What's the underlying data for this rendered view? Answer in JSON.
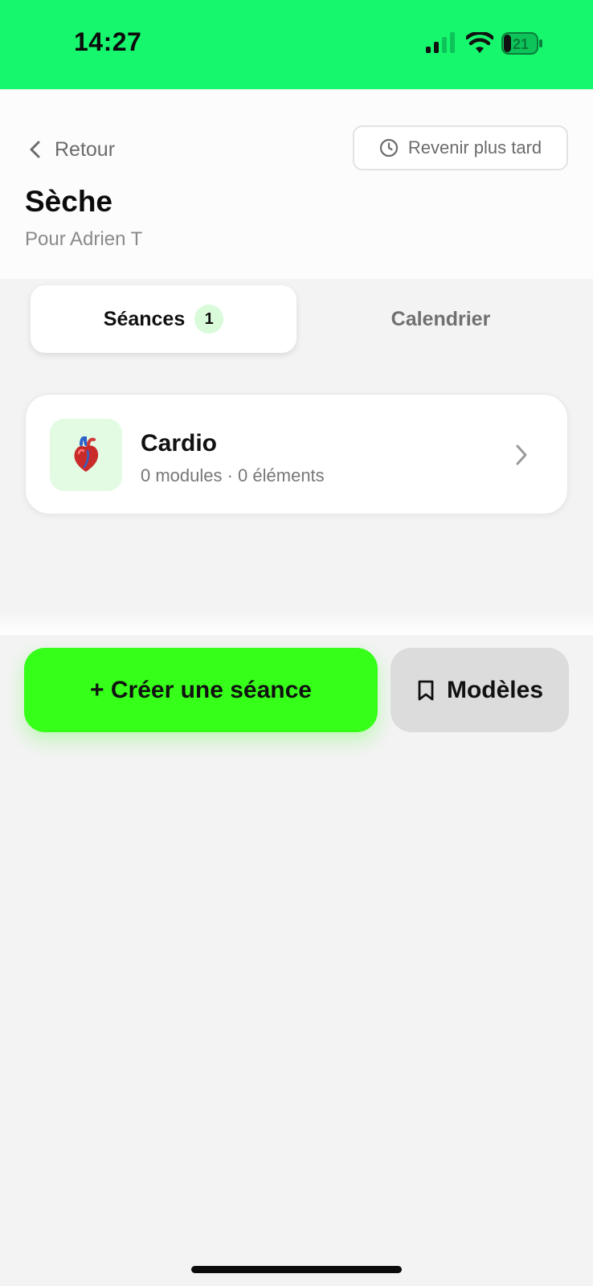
{
  "status_bar": {
    "time": "14:27",
    "battery_level": "21",
    "accent": "#16f76e"
  },
  "header": {
    "back_label": "Retour",
    "later_label": "Revenir plus tard",
    "title": "Sèche",
    "subtitle": "Pour Adrien T"
  },
  "tabs": [
    {
      "label": "Séances",
      "badge": "1",
      "active": true
    },
    {
      "label": "Calendrier",
      "active": false
    }
  ],
  "sessions": [
    {
      "title": "Cardio",
      "meta": "0 modules · 0 éléments",
      "icon": "anatomical-heart-icon"
    }
  ],
  "actions": {
    "create_label": "+ Créer une séance",
    "models_label": "Modèles",
    "create_color": "#36ff1a"
  }
}
